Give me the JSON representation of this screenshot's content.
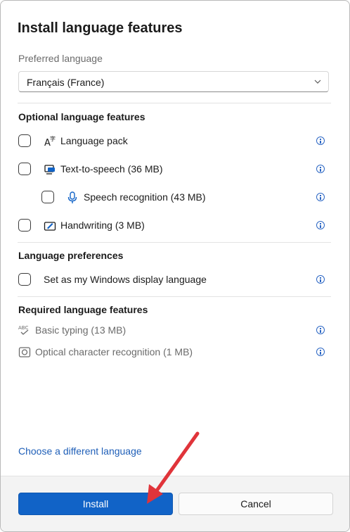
{
  "dialog": {
    "title": "Install language features",
    "preferred_language_label": "Preferred language",
    "preferred_language_value": "Français (France)"
  },
  "optional": {
    "title": "Optional language features",
    "items": [
      {
        "label": "Language pack",
        "icon": "language-pack-icon"
      },
      {
        "label": "Text-to-speech (36 MB)",
        "icon": "text-to-speech-icon"
      },
      {
        "label": "Speech recognition (43 MB)",
        "icon": "microphone-icon"
      },
      {
        "label": "Handwriting (3 MB)",
        "icon": "pen-icon"
      }
    ]
  },
  "preferences": {
    "title": "Language preferences",
    "items": [
      {
        "label": "Set as my Windows display language"
      }
    ]
  },
  "required": {
    "title": "Required language features",
    "items": [
      {
        "label": "Basic typing (13 MB)",
        "icon": "spell-check-icon"
      },
      {
        "label": "Optical character recognition (1 MB)",
        "icon": "camera-ocr-icon"
      }
    ]
  },
  "link": {
    "label": "Choose a different language"
  },
  "buttons": {
    "install": "Install",
    "cancel": "Cancel"
  },
  "colors": {
    "accent": "#1163c7",
    "link": "#1f5fb8",
    "annotation_arrow": "#e0343a"
  }
}
